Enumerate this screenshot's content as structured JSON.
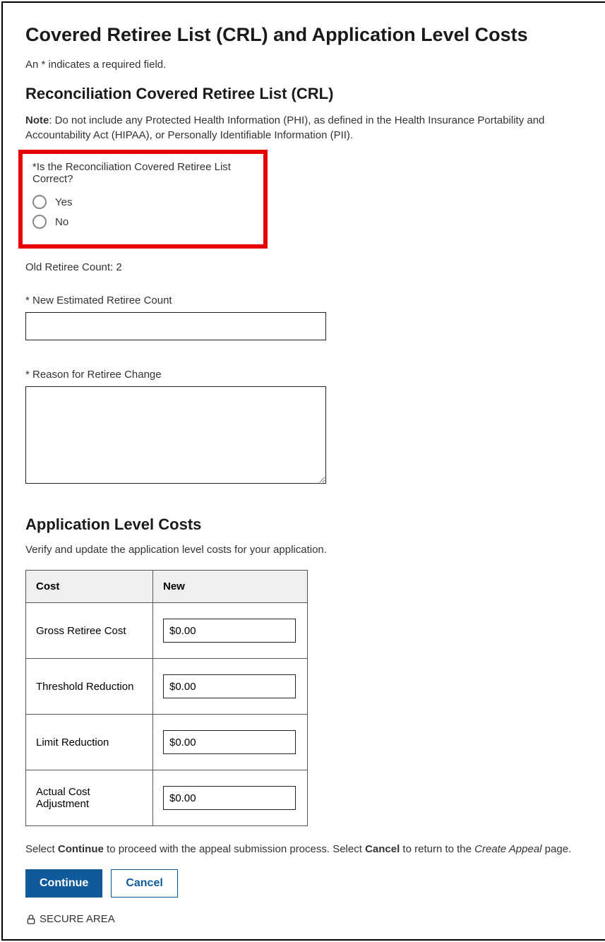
{
  "page_title": "Covered Retiree List (CRL) and Application Level Costs",
  "required_note": "An * indicates a required field.",
  "section1": {
    "heading": "Reconciliation Covered Retiree List (CRL)",
    "note_bold": "Note",
    "note_rest": ": Do not include any Protected Health Information (PHI), as defined in the Health Insurance Portability and Accountability Act (HIPAA), or Personally Identifiable Information (PII).",
    "question": "*Is the Reconciliation Covered Retiree List Correct?",
    "option_yes": "Yes",
    "option_no": "No",
    "old_count_label": "Old Retiree Count: 2",
    "new_count_label": "* New Estimated Retiree Count",
    "new_count_value": "",
    "reason_label": "* Reason for Retiree Change",
    "reason_value": ""
  },
  "section2": {
    "heading": "Application Level Costs",
    "subtext": "Verify and update the application level costs for your application.",
    "col_cost": "Cost",
    "col_new": "New",
    "rows": [
      {
        "label": "Gross Retiree Cost",
        "value": "$0.00"
      },
      {
        "label": "Threshold Reduction",
        "value": "$0.00"
      },
      {
        "label": "Limit Reduction",
        "value": "$0.00"
      },
      {
        "label": "Actual Cost Adjustment",
        "value": "$0.00"
      }
    ]
  },
  "instruction": {
    "pre": "Select ",
    "b1": "Continue",
    "mid": " to proceed with the appeal submission process. Select ",
    "b2": "Cancel",
    "post1": " to return to the ",
    "italic": "Create Appeal",
    "post2": " page."
  },
  "buttons": {
    "continue": "Continue",
    "cancel": "Cancel"
  },
  "secure": "SECURE AREA"
}
